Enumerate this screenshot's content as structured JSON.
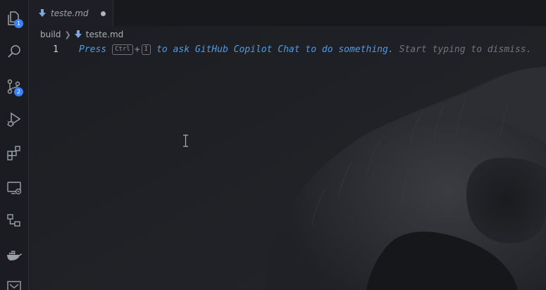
{
  "tab": {
    "label": "teste.md",
    "icon": "markdown-icon",
    "dirty": true
  },
  "breadcrumb": {
    "folder": "build",
    "file": "teste.md"
  },
  "activity_bar": {
    "items": [
      {
        "name": "explorer-icon",
        "badge": "1"
      },
      {
        "name": "search-icon"
      },
      {
        "name": "source-control-icon",
        "badge": "2"
      },
      {
        "name": "run-debug-icon"
      },
      {
        "name": "extensions-icon"
      },
      {
        "name": "remote-explorer-icon"
      },
      {
        "name": "source-tree-icon"
      },
      {
        "name": "docker-icon"
      },
      {
        "name": "shell-icon"
      }
    ]
  },
  "editor": {
    "line_number": "1",
    "hint": {
      "press": "Press",
      "key1": "Ctrl",
      "plus": "+",
      "key2": "I",
      "action": "to ask GitHub Copilot Chat to do something.",
      "dismiss": "Start typing to dismiss."
    }
  },
  "colors": {
    "accent": "#4f9be8",
    "badge": "#3b82f6",
    "background": "#1c1e23"
  }
}
